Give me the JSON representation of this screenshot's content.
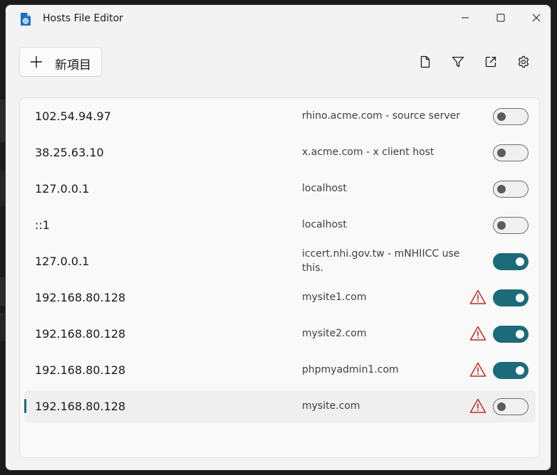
{
  "window": {
    "title": "Hosts File Editor"
  },
  "toolbar": {
    "new_label": "新項目"
  },
  "icons": {
    "app": "hosts-file-icon",
    "new": "plus-icon",
    "document": "document-icon",
    "filter": "filter-icon",
    "open_external": "open-external-icon",
    "settings": "gear-icon",
    "warning": "warning-icon"
  },
  "colors": {
    "accent": "#1c6b7a",
    "warning": "#c42b1c"
  },
  "entries": [
    {
      "ip": "102.54.94.97",
      "host": "rhino.acme.com - source server",
      "active": false,
      "warning": false,
      "selected": false
    },
    {
      "ip": "38.25.63.10",
      "host": "x.acme.com - x client host",
      "active": false,
      "warning": false,
      "selected": false
    },
    {
      "ip": "127.0.0.1",
      "host": "localhost",
      "active": false,
      "warning": false,
      "selected": false
    },
    {
      "ip": "::1",
      "host": "localhost",
      "active": false,
      "warning": false,
      "selected": false
    },
    {
      "ip": "127.0.0.1",
      "host": "iccert.nhi.gov.tw - mNHIICC use this.",
      "active": true,
      "warning": false,
      "selected": false
    },
    {
      "ip": "192.168.80.128",
      "host": "mysite1.com",
      "active": true,
      "warning": true,
      "selected": false
    },
    {
      "ip": "192.168.80.128",
      "host": "mysite2.com",
      "active": true,
      "warning": true,
      "selected": false
    },
    {
      "ip": "192.168.80.128",
      "host": "phpmyadmin1.com",
      "active": true,
      "warning": true,
      "selected": false
    },
    {
      "ip": "192.168.80.128",
      "host": "mysite.com",
      "active": false,
      "warning": true,
      "selected": true
    }
  ]
}
